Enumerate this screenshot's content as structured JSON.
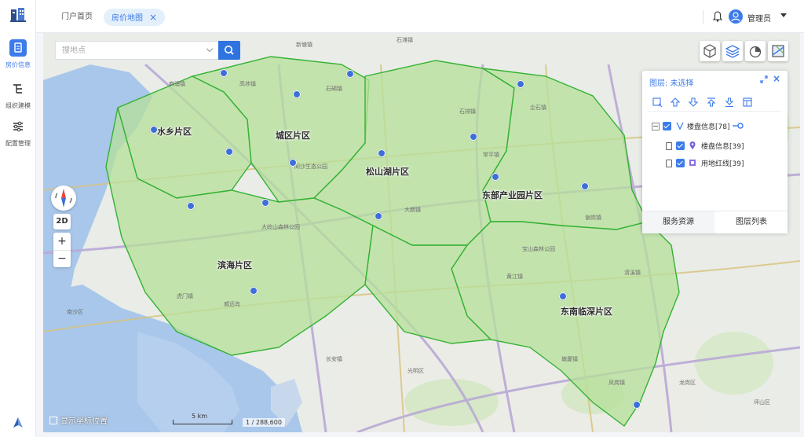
{
  "sidebar": {
    "items": [
      {
        "label": "房价信息",
        "icon": "house-document-icon",
        "active": true
      },
      {
        "label": "组织建模",
        "icon": "hierarchy-icon",
        "active": false
      },
      {
        "label": "配置管理",
        "icon": "sliders-icon",
        "active": false
      }
    ]
  },
  "header": {
    "tabs": [
      {
        "label": "门户首页",
        "active": false
      },
      {
        "label": "房价地图",
        "active": true,
        "close": "×"
      }
    ],
    "user": {
      "name": "管理员"
    }
  },
  "search": {
    "placeholder": "搜地点"
  },
  "map": {
    "zones": [
      "水乡片区",
      "城区片区",
      "松山湖片区",
      "东部产业园片区",
      "滨海片区",
      "东南临深片区"
    ],
    "places": [
      "石滩镇",
      "新塘镇",
      "麻涌镇",
      "高埗镇",
      "石碣镇",
      "石排镇",
      "企石镇",
      "谢岗镇",
      "凤岗镇",
      "大岭山森林公园",
      "威远岛",
      "虎门镇",
      "长安镇",
      "大朗镇",
      "黄江镇",
      "清溪镇",
      "塘厦镇",
      "常平镇",
      "南沙区",
      "光明区",
      "龙岗区",
      "坪山区",
      "同沙生态公园",
      "宝山森林公园"
    ],
    "controls": {
      "mode_2d": "2D",
      "zoom_in": "+",
      "zoom_out": "−"
    },
    "coord_toggle": "显示坐标位置",
    "scale": "5 km",
    "ratio": "1 / 288,600",
    "accent": "#3d7bea",
    "zone_fill": "#b6e09a",
    "zone_border": "#34b233"
  },
  "layer_panel": {
    "title": "图层: 未选择",
    "close": "×",
    "tree": [
      {
        "label": "楼盘信息[78]",
        "level": 0
      },
      {
        "label": "楼盘信息[39]",
        "level": 1
      },
      {
        "label": "用地红线[39]",
        "level": 1
      }
    ],
    "tabs": [
      "服务资源",
      "图层列表"
    ],
    "active_tab": "图层列表"
  }
}
